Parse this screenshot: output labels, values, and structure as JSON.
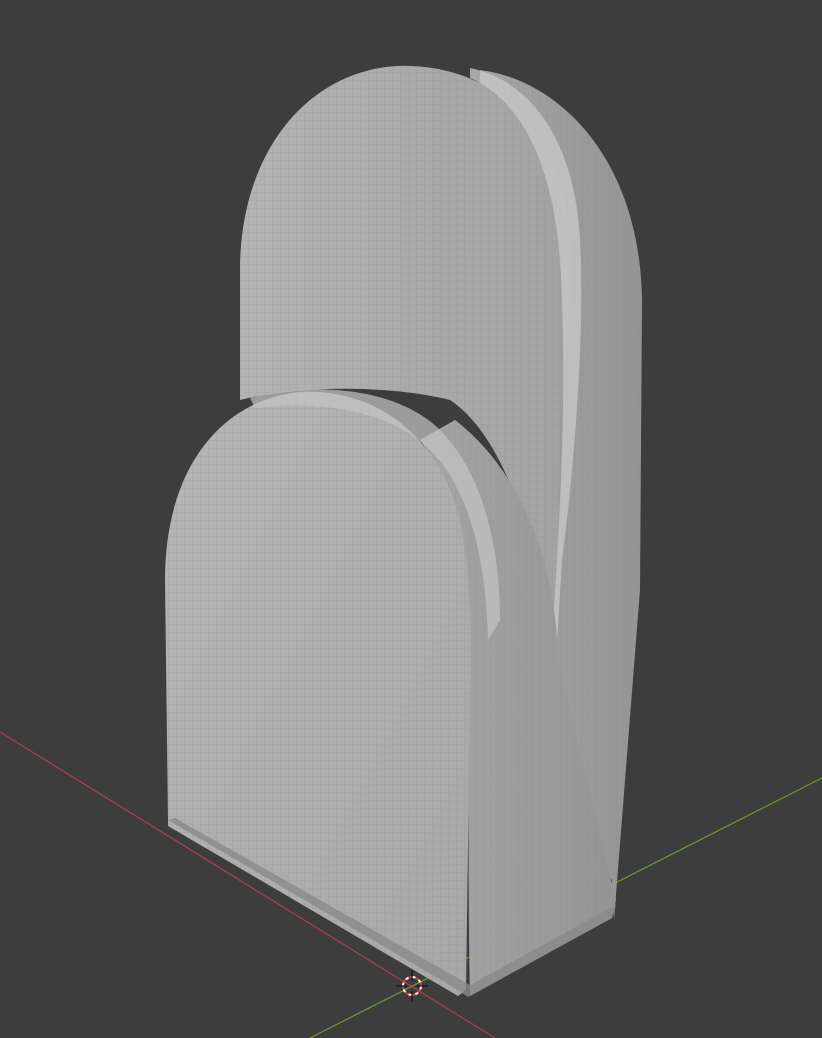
{
  "viewport": {
    "background_color": "#3d3d3d",
    "x_axis_color": "#a8434c",
    "y_axis_color": "#6e9a2b",
    "mesh_color": "#a9a9a9",
    "cursor_color_a": "#d13a3a",
    "cursor_color_b": "#ffffff"
  },
  "scene": {
    "object": "subdivided-arch-block-mesh",
    "cursor": "3d-cursor-icon",
    "x_axis": "x-axis-line",
    "y_axis": "y-axis-line"
  }
}
